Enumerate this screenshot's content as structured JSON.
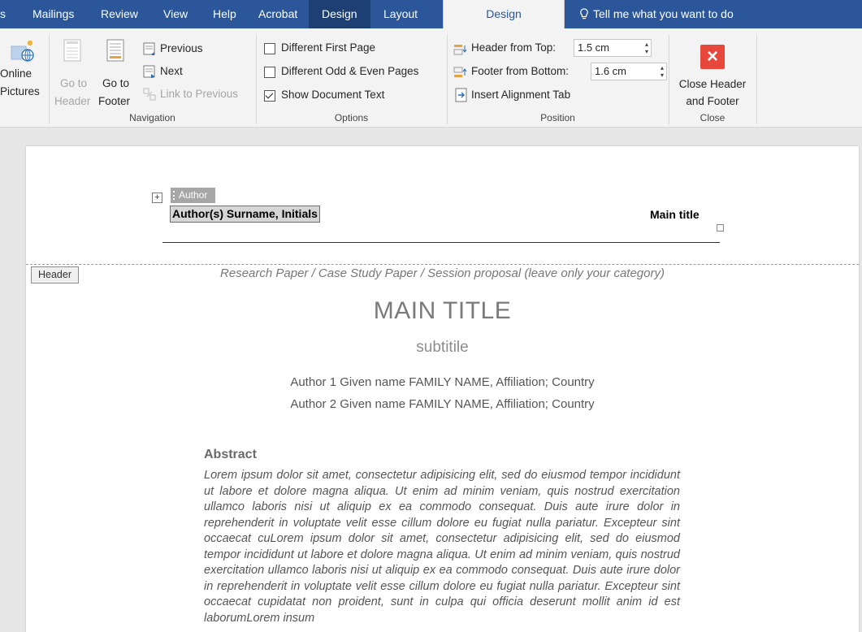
{
  "tabs": {
    "cut_letter": "s",
    "mailings": "Mailings",
    "review": "Review",
    "view": "View",
    "help": "Help",
    "acrobat": "Acrobat",
    "design_dark": "Design",
    "layout": "Layout",
    "design_active": "Design",
    "tell_me": "Tell me what you want to do"
  },
  "ribbon": {
    "insert": {
      "online_line1": "Online",
      "online_line2": "Pictures"
    },
    "navigation": {
      "go_to_header_line1": "Go to",
      "go_to_header_line2": "Header",
      "go_to_footer_line1": "Go to",
      "go_to_footer_line2": "Footer",
      "previous": "Previous",
      "next": "Next",
      "link_to_previous": "Link to Previous",
      "label": "Navigation"
    },
    "options": {
      "different_first_page": "Different First Page",
      "different_odd_even": "Different Odd & Even Pages",
      "show_document_text": "Show Document Text",
      "label": "Options"
    },
    "position": {
      "header_from_top_label": "Header from Top:",
      "header_from_top_value": "1.5 cm",
      "footer_from_bottom_label": "Footer from Bottom:",
      "footer_from_bottom_value": "1.6 cm",
      "insert_alignment_tab": "Insert Alignment Tab",
      "label": "Position"
    },
    "close": {
      "close_line1": "Close Header",
      "close_line2": "and Footer",
      "label": "Close"
    }
  },
  "header_area": {
    "author_tag": "Author",
    "author_field": "Author(s) Surname, Initials",
    "main_title": "Main title",
    "header_label": "Header"
  },
  "document": {
    "category": "Research Paper / Case Study Paper / Session proposal (leave only your category)",
    "title": "MAIN TITLE",
    "subtitle": "subtitile",
    "author1": "Author 1 Given name FAMILY NAME, Affiliation; Country",
    "author2": "Author 2 Given name FAMILY NAME, Affiliation; Country",
    "abstract_heading": "Abstract",
    "abstract_text": "Lorem ipsum dolor sit amet, consectetur adipisicing elit, sed do eiusmod tempor incididunt ut labore et dolore magna aliqua. Ut enim ad minim veniam, quis nostrud exercitation ullamco laboris nisi ut aliquip ex ea commodo consequat. Duis aute irure dolor in reprehenderit in voluptate velit esse cillum dolore eu fugiat nulla pariatur. Excepteur sint occaecat cuLorem ipsum dolor sit amet, consectetur adipisicing elit, sed do eiusmod tempor incididunt ut labore et dolore magna aliqua. Ut enim ad minim veniam, quis nostrud exercitation ullamco laboris nisi ut aliquip ex ea commodo consequat. Duis aute irure dolor in reprehenderit in voluptate velit esse cillum dolore eu fugiat nulla pariatur. Excepteur sint occaecat cupidatat non proident, sunt in culpa qui officia deserunt mollit anim id est laborumLorem insum"
  }
}
